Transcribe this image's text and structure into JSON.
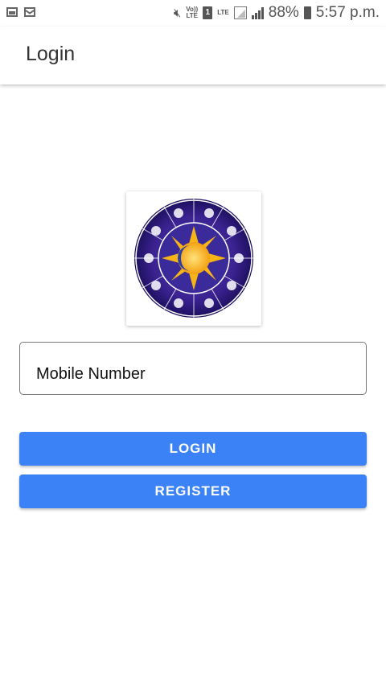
{
  "status_bar": {
    "volte_label": "Vo))\nLTE",
    "sim_label": "1",
    "lte_label": "LTE",
    "battery": "88%",
    "time": "5:57 p.m."
  },
  "app_bar": {
    "title": "Login"
  },
  "logo": {
    "icon": "zodiac-wheel-logo"
  },
  "form": {
    "mobile_placeholder": "Mobile Number",
    "mobile_value": ""
  },
  "buttons": {
    "login": "LOGIN",
    "register": "REGISTER"
  },
  "colors": {
    "primary": "#3b82f6",
    "logo_ring": "#2a1a7a",
    "logo_sun": "#f6b417"
  }
}
